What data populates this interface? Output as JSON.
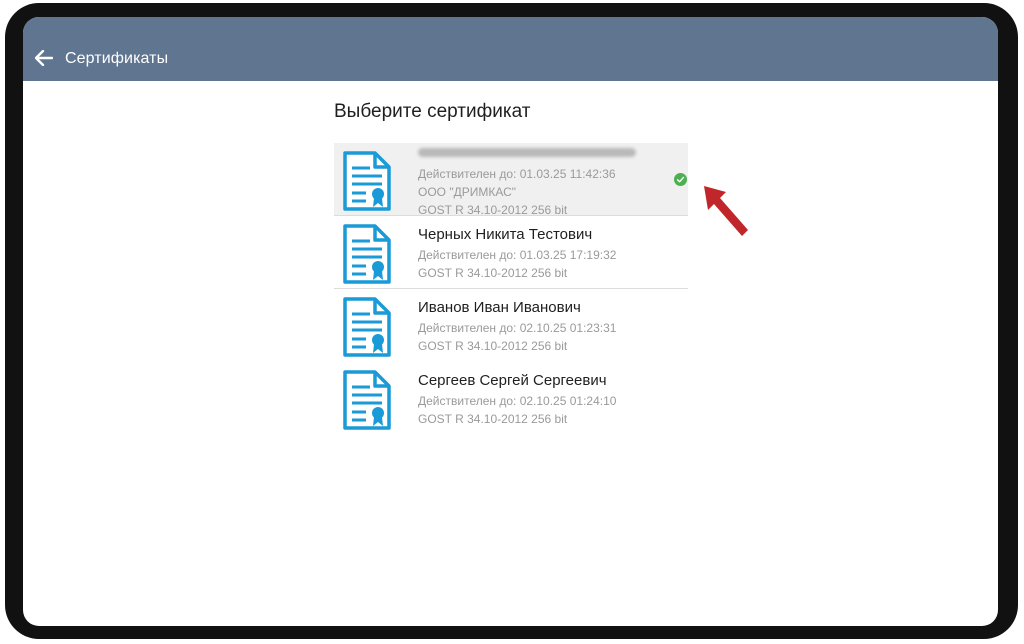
{
  "appbar": {
    "back_icon": "arrow-back-icon",
    "title": "Сертификаты",
    "background": "#5f7590"
  },
  "page": {
    "heading": "Выберите сертификат"
  },
  "certificates": [
    {
      "name": "",
      "name_obscured": true,
      "valid_until": "Действителен до: 01.03.25 11:42:36",
      "organization": "ООО \"ДРИМКАС\"",
      "algorithm": "GOST R 34.10-2012 256 bit",
      "selected": true,
      "status_icon": "check-circle-icon",
      "status_color": "#4caf50"
    },
    {
      "name": "Черных Никита Тестович",
      "valid_until": "Действителен до: 01.03.25 17:19:32",
      "algorithm": "GOST R 34.10-2012 256 bit",
      "selected": false
    },
    {
      "name": "Иванов Иван Иванович",
      "valid_until": "Действителен до: 02.10.25 01:23:31",
      "algorithm": "GOST R 34.10-2012 256 bit",
      "selected": false
    },
    {
      "name": "Сергеев Сергей Сергеевич",
      "valid_until": "Действителен до: 02.10.25 01:24:10",
      "algorithm": "GOST R 34.10-2012 256 bit",
      "selected": false
    }
  ],
  "colors": {
    "accent_icon": "#1a9ad6",
    "annotation_arrow": "#c0262a"
  },
  "annotation": {
    "icon": "red-arrow-pointer-icon"
  }
}
